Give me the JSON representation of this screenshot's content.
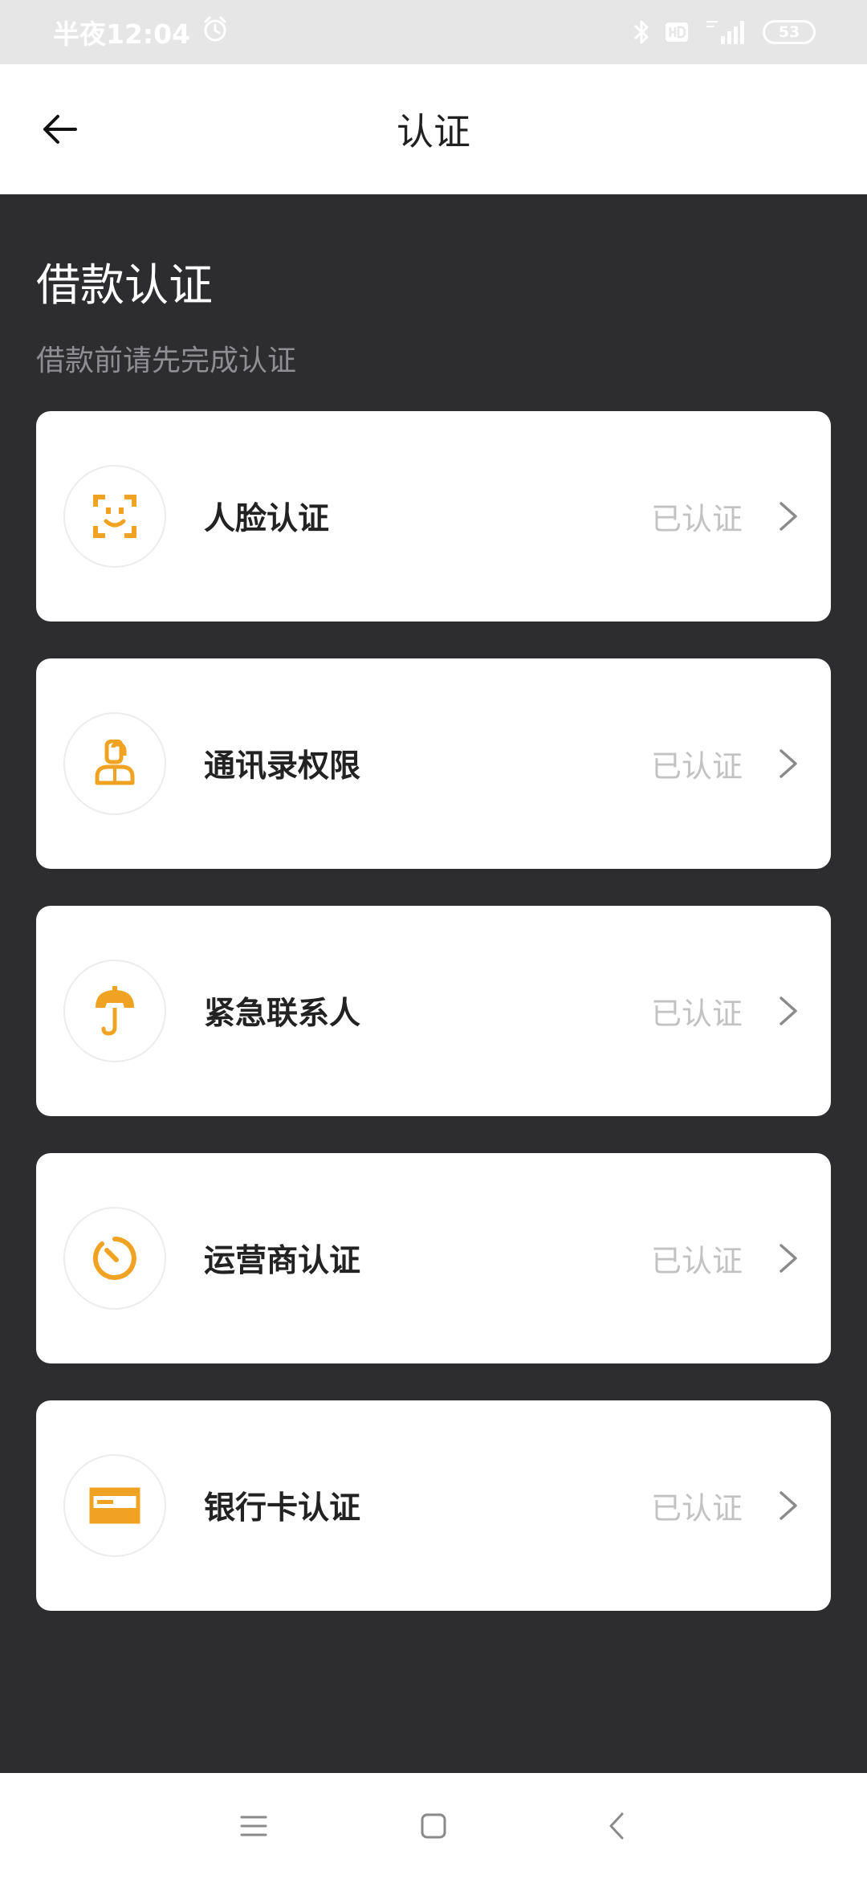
{
  "status_bar": {
    "time": "半夜12:04",
    "battery": "53"
  },
  "header": {
    "title": "认证"
  },
  "section": {
    "title": "借款认证",
    "subtitle": "借款前请先完成认证"
  },
  "items": [
    {
      "label": "人脸认证",
      "status": "已认证",
      "icon": "face-scan-icon"
    },
    {
      "label": "通讯录权限",
      "status": "已认证",
      "icon": "contacts-icon"
    },
    {
      "label": "紧急联系人",
      "status": "已认证",
      "icon": "umbrella-icon"
    },
    {
      "label": "运营商认证",
      "status": "已认证",
      "icon": "timer-icon"
    },
    {
      "label": "银行卡认证",
      "status": "已认证",
      "icon": "bank-card-icon"
    }
  ],
  "colors": {
    "accent": "#f0a323",
    "background": "#2d2d30",
    "card": "#ffffff",
    "status_text": "#c2c2c2"
  }
}
